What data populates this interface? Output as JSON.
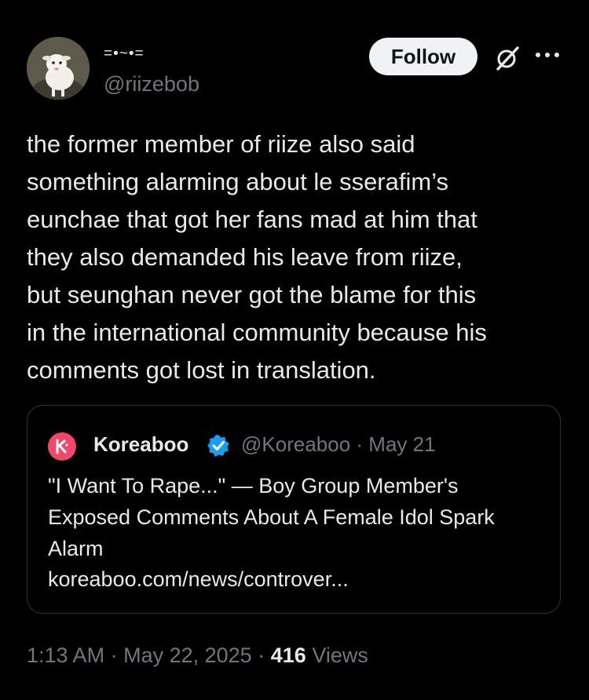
{
  "author": {
    "display_name": "=•~•=",
    "handle": "@riizebob",
    "avatar_icon": "goat-avatar"
  },
  "actions": {
    "follow_label": "Follow",
    "grok_icon": "grok-icon",
    "more_icon": "more-icon"
  },
  "tweet": {
    "text": "the former member of riize also said\nsomething alarming about le sserafim’s\neunchae that got her fans mad at him that\nthey also demanded his leave from riize,\nbut seunghan never got the blame for this\nin the international community because his\ncomments got lost in translation."
  },
  "quote": {
    "account_name": "Koreaboo",
    "handle": "@Koreaboo",
    "separator": "·",
    "date": "May 21",
    "title": "\"I Want To Rape...\" — Boy Group Member's Exposed Comments About A Female Idol Spark Alarm",
    "link": "koreaboo.com/news/controver..."
  },
  "footer": {
    "time": "1:13 AM",
    "date": "May 22, 2025",
    "separator": "·",
    "views_count": "416",
    "views_label": "Views"
  },
  "colors": {
    "background": "#000000",
    "text": "#e7e9ea",
    "muted": "#71767b",
    "verified": "#1d9bf0",
    "koreaboo_brand": "#f0476b"
  }
}
